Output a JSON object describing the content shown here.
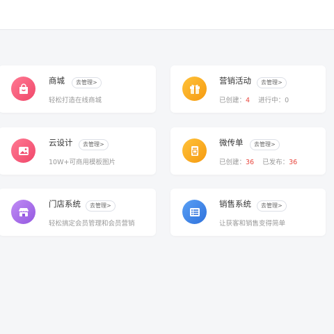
{
  "cards": [
    {
      "title": "商城",
      "manage": "去管理>",
      "subtitle": "轻松打造在线商城",
      "icon": "shopping-bag-icon",
      "color": "#f25c7a"
    },
    {
      "title": "营销活动",
      "manage": "去管理>",
      "stats": [
        {
          "label": "已创建：",
          "value": "4"
        },
        {
          "label": "进行中：",
          "value": "0"
        }
      ],
      "icon": "gift-box-icon",
      "color": "#f7a21b"
    },
    {
      "title": "云设计",
      "manage": "去管理>",
      "subtitle": "10W+可商用模板图片",
      "icon": "image-icon",
      "color": "#f25c7a"
    },
    {
      "title": "微传单",
      "manage": "去管理>",
      "stats": [
        {
          "label": "已创建：",
          "value": "36"
        },
        {
          "label": "已发布：",
          "value": "36"
        }
      ],
      "icon": "flyer-icon",
      "color": "#f7a21b"
    },
    {
      "title": "门店系统",
      "manage": "去管理>",
      "subtitle": "轻松搞定会员管理和会员营销",
      "icon": "storefront-icon",
      "color": "#a86ce8"
    },
    {
      "title": "销售系统",
      "manage": "去管理>",
      "subtitle": "让获客和销售变得简单",
      "icon": "list-icon",
      "color": "#3d82e6"
    }
  ]
}
